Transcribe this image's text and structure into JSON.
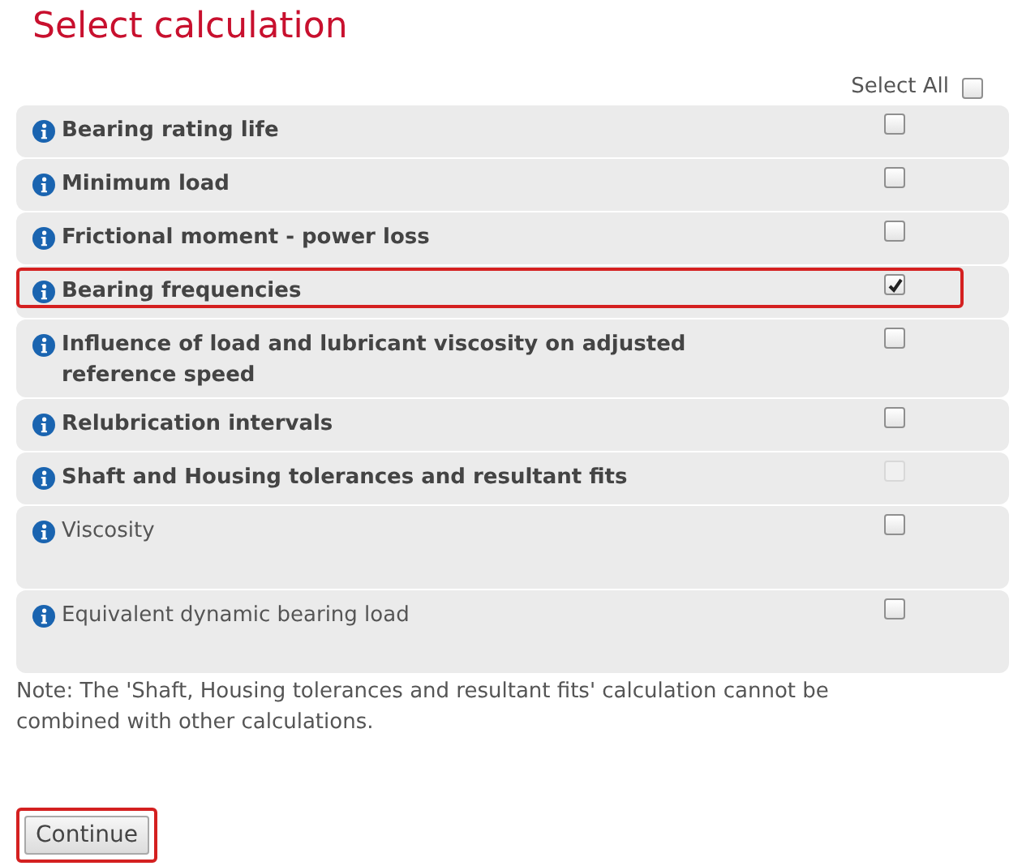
{
  "title": "Select calculation",
  "select_all": {
    "label": "Select All",
    "checked": false
  },
  "calculations": [
    {
      "label": "Bearing rating life",
      "kind": "bold",
      "checked": false,
      "disabled": false,
      "highlighted": false
    },
    {
      "label": "Minimum load",
      "kind": "bold",
      "checked": false,
      "disabled": false,
      "highlighted": false
    },
    {
      "label": "Frictional moment - power loss",
      "kind": "bold",
      "checked": false,
      "disabled": false,
      "highlighted": false
    },
    {
      "label": "Bearing frequencies",
      "kind": "bold",
      "checked": true,
      "disabled": false,
      "highlighted": true
    },
    {
      "label": "Influence of load and lubricant viscosity on adjusted reference speed",
      "kind": "bold",
      "checked": false,
      "disabled": false,
      "highlighted": false
    },
    {
      "label": "Relubrication intervals",
      "kind": "bold",
      "checked": false,
      "disabled": false,
      "highlighted": false
    },
    {
      "label": "Shaft and Housing tolerances and resultant fits",
      "kind": "bold",
      "checked": false,
      "disabled": true,
      "highlighted": false
    },
    {
      "label": "Viscosity",
      "kind": "plain",
      "checked": false,
      "disabled": false,
      "highlighted": false
    },
    {
      "label": "Equivalent dynamic bearing load",
      "kind": "plain",
      "checked": false,
      "disabled": false,
      "highlighted": false
    }
  ],
  "note": "Note: The 'Shaft, Housing tolerances and resultant fits' calculation cannot be combined with other calculations.",
  "continue_button": {
    "label": "Continue",
    "highlighted": true
  }
}
